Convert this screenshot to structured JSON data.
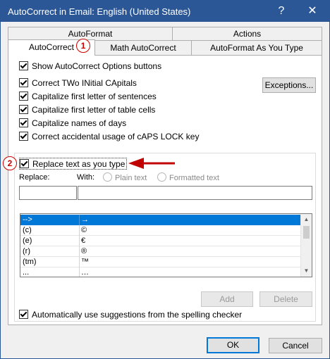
{
  "window": {
    "title": "AutoCorrect in Email: English (United States)",
    "help_glyph": "?",
    "close_glyph": "✕"
  },
  "tabs": [
    {
      "label": "AutoFormat"
    },
    {
      "label": "Actions"
    },
    {
      "label": "AutoCorrect"
    },
    {
      "label": "Math AutoCorrect"
    },
    {
      "label": "AutoFormat As You Type"
    }
  ],
  "annotations": {
    "badge1": "1",
    "badge2": "2"
  },
  "options": {
    "show_buttons": "Show AutoCorrect Options buttons",
    "correct_two_initial": "Correct TWo INitial CApitals",
    "cap_sentences": "Capitalize first letter of sentences",
    "cap_table_cells": "Capitalize first letter of table cells",
    "cap_days": "Capitalize names of days",
    "caps_lock": "Correct accidental usage of cAPS LOCK key",
    "replace_text": "Replace text as you type",
    "auto_suggestions": "Automatically use suggestions from the spelling checker"
  },
  "exceptions_label": "Exceptions...",
  "replace": {
    "replace_label": "Replace:",
    "with_label": "With:",
    "plain_text": "Plain text",
    "formatted_text": "Formatted text",
    "replace_value": "",
    "with_value": ""
  },
  "entries": [
    {
      "from": "-->",
      "to": "→"
    },
    {
      "from": "(c)",
      "to": "©"
    },
    {
      "from": "(e)",
      "to": "€"
    },
    {
      "from": "(r)",
      "to": "®"
    },
    {
      "from": "(tm)",
      "to": "™"
    },
    {
      "from": "...",
      "to": "…"
    }
  ],
  "buttons": {
    "add": "Add",
    "delete": "Delete",
    "ok": "OK",
    "cancel": "Cancel"
  },
  "colors": {
    "titlebar": "#2b5797",
    "selection": "#0078d7",
    "annotation": "#c00000"
  }
}
